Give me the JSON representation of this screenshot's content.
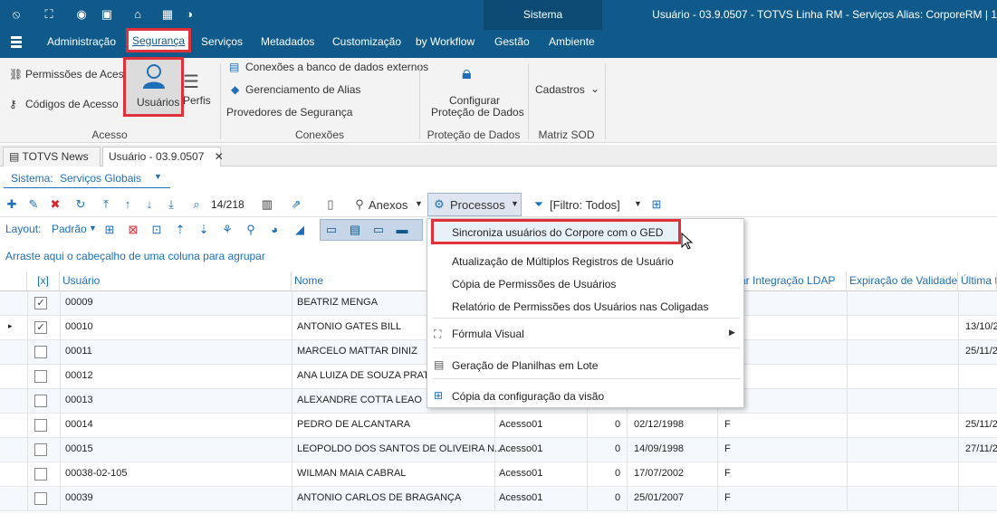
{
  "title_bar": {
    "system_label": "Sistema",
    "app_title": "Usuário - 03.9.0507 - TOTVS Linha RM - Serviços  Alias: CorporeRM | 1"
  },
  "menu": {
    "items": [
      "Administração",
      "Segurança",
      "Serviços",
      "Metadados",
      "Customização",
      "by Workflow",
      "Gestão",
      "Ambiente"
    ]
  },
  "ribbon": {
    "permissoes": "Permissões de Acesso",
    "codigos": "Códigos de Acesso",
    "usuarios": "Usuários",
    "perfis": "Perfis",
    "grp_acesso": "Acesso",
    "conexoes_ext": "Conexões a banco de dados externos",
    "ger_alias": "Gerenciamento de Alias",
    "provedores": "Provedores de Segurança",
    "grp_conexoes": "Conexões",
    "config_l1": "Configurar",
    "config_l2": "Proteção de Dados",
    "grp_protecao": "Proteção de Dados",
    "cadastros": "Cadastros",
    "grp_matriz": "Matriz SOD"
  },
  "tabs": [
    {
      "label": "TOTVS News"
    },
    {
      "label": "Usuário - 03.9.0507"
    }
  ],
  "sistema": {
    "label": "Sistema:",
    "value": "Serviços Globais"
  },
  "toolbar": {
    "count": "14/218",
    "anexos": "Anexos",
    "processos": "Processos",
    "filtro": "[Filtro: Todos]",
    "layout_label": "Layout:",
    "layout_value": "Padrão"
  },
  "group_hint": "Arraste aqui o cabeçalho de uma coluna para agrupar",
  "grid": {
    "headers": {
      "check": "[x]",
      "usuario": "Usuário",
      "nome": "Nome",
      "ldap": "ar Integração LDAP",
      "expiracao": "Expiração de Validade",
      "ultima": "Última te"
    },
    "rows": [
      {
        "checked": "✓",
        "usuario": "00009",
        "nome": "BEATRIZ MENGA",
        "acesso": "",
        "zero": "",
        "data": "",
        "f": "",
        "ultima": ""
      },
      {
        "checked": "✓",
        "usuario": "00010",
        "nome": "ANTONIO GATES BILL",
        "acesso": "",
        "zero": "",
        "data": "",
        "f": "",
        "ultima": "13/10/2"
      },
      {
        "checked": "",
        "usuario": "00011",
        "nome": "MARCELO MATTAR DINIZ",
        "acesso": "",
        "zero": "",
        "data": "",
        "f": "",
        "ultima": "25/11/2"
      },
      {
        "checked": "",
        "usuario": "00012",
        "nome": "ANA LUIZA  DE SOUZA PRATES",
        "acesso": "",
        "zero": "",
        "data": "",
        "f": "",
        "ultima": ""
      },
      {
        "checked": "",
        "usuario": "00013",
        "nome": "ALEXANDRE COTTA LEAO",
        "acesso": "",
        "zero": "",
        "data": "",
        "f": "",
        "ultima": ""
      },
      {
        "checked": "",
        "usuario": "00014",
        "nome": "PEDRO DE ALCANTARA",
        "acesso": "Acesso01",
        "zero": "0",
        "data": "02/12/1998",
        "f": "F",
        "ultima": "25/11/2"
      },
      {
        "checked": "",
        "usuario": "00015",
        "nome": "LEOPOLDO DOS SANTOS DE OLIVEIRA N...",
        "acesso": "Acesso01",
        "zero": "0",
        "data": "14/09/1998",
        "f": "F",
        "ultima": "27/11/2"
      },
      {
        "checked": "",
        "usuario": "00038-02-105",
        "nome": "WILMAN MAIA CABRAL",
        "acesso": "Acesso01",
        "zero": "0",
        "data": "17/07/2002",
        "f": "F",
        "ultima": ""
      },
      {
        "checked": "",
        "usuario": "00039",
        "nome": "ANTONIO CARLOS DE BRAGANÇA",
        "acesso": "Acesso01",
        "zero": "0",
        "data": "25/01/2007",
        "f": "F",
        "ultima": ""
      }
    ]
  },
  "dropdown": {
    "items": [
      "Sincroniza usuários do Corpore com o GED",
      "Atualização de Múltiplos Registros de Usuário",
      "Cópia de Permissões de Usuários",
      "Relatório de Permissões dos Usuários nas Coligadas",
      "Fórmula Visual",
      "Geração de Planilhas em Lote",
      "Cópia da configuração da visão"
    ]
  }
}
